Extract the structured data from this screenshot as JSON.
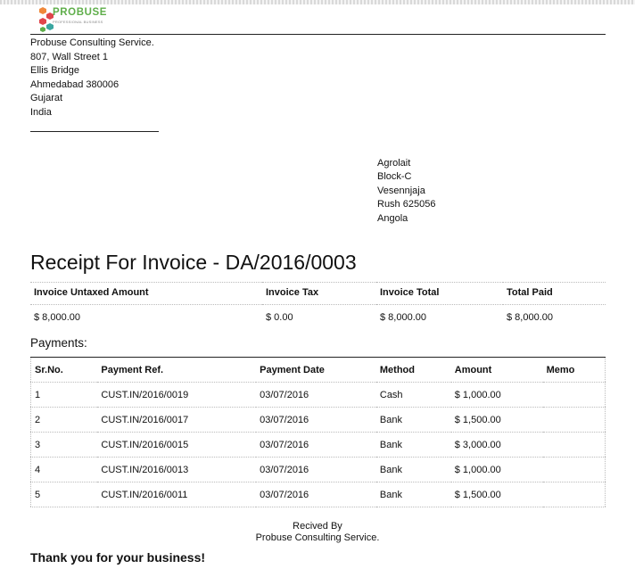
{
  "logo": {
    "brand": "PROBUSE",
    "tagline": "PROFESSIONAL BUSINESS"
  },
  "company": {
    "lines": [
      "Probuse Consulting Service.",
      "807, Wall Street 1",
      "Ellis Bridge",
      "Ahmedabad 380006",
      "Gujarat",
      "India"
    ]
  },
  "customer": {
    "lines": [
      "Agrolait",
      "Block-C",
      "Vesennjaja",
      "Rush 625056",
      "Angola"
    ]
  },
  "title": "Receipt For Invoice - DA/2016/0003",
  "summary": {
    "headers": [
      "Invoice Untaxed Amount",
      "Invoice Tax",
      "Invoice Total",
      "Total Paid"
    ],
    "values": [
      "$ 8,000.00",
      "$ 0.00",
      "$ 8,000.00",
      "$ 8,000.00"
    ]
  },
  "payments_label": "Payments:",
  "payments": {
    "headers": [
      "Sr.No.",
      "Payment Ref.",
      "Payment Date",
      "Method",
      "Amount",
      "Memo"
    ],
    "rows": [
      [
        "1",
        "CUST.IN/2016/0019",
        "03/07/2016",
        "Cash",
        "$ 1,000.00",
        ""
      ],
      [
        "2",
        "CUST.IN/2016/0017",
        "03/07/2016",
        "Bank",
        "$ 1,500.00",
        ""
      ],
      [
        "3",
        "CUST.IN/2016/0015",
        "03/07/2016",
        "Bank",
        "$ 3,000.00",
        ""
      ],
      [
        "4",
        "CUST.IN/2016/0013",
        "03/07/2016",
        "Bank",
        "$ 1,000.00",
        ""
      ],
      [
        "5",
        "CUST.IN/2016/0011",
        "03/07/2016",
        "Bank",
        "$ 1,500.00",
        ""
      ]
    ]
  },
  "signature": {
    "label": "Recived By",
    "name": "Probuse Consulting Service."
  },
  "thanks": "Thank you for your business!",
  "colors": {
    "logo_green": "#5fae4a",
    "logo_orange": "#f0883a",
    "logo_red": "#e0454b",
    "logo_teal": "#3aa6a0"
  }
}
